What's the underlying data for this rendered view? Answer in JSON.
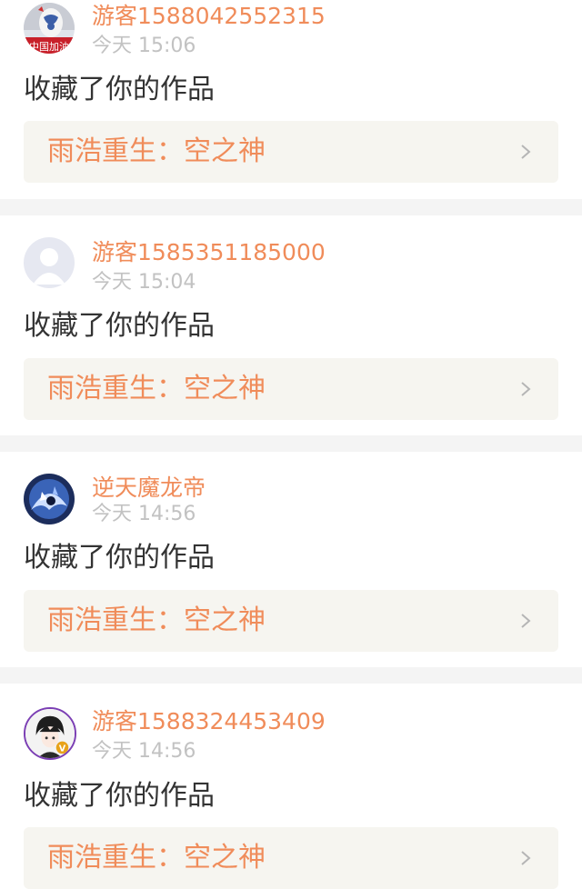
{
  "notifications": [
    {
      "user": "游客1588042552315",
      "time": "今天 15:06",
      "action": "收藏了你的作品",
      "work": "雨浩重生：空之神",
      "avatar": "porcelain-avatar",
      "avatar_text": "中国加油"
    },
    {
      "user": "游客1585351185000",
      "time": "今天 15:04",
      "action": "收藏了你的作品",
      "work": "雨浩重生：空之神",
      "avatar": "default-user-avatar"
    },
    {
      "user": "逆天魔龙帝",
      "time": "今天 14:56",
      "action": "收藏了你的作品",
      "work": "雨浩重生：空之神",
      "avatar": "dragon-avatar"
    },
    {
      "user": "游客1588324453409",
      "time": "今天 14:56",
      "action": "收藏了你的作品",
      "work": "雨浩重生：空之神",
      "avatar": "anime-boy-avatar",
      "avatar_badge": "V"
    }
  ],
  "colors": {
    "accent": "#f08c5a",
    "text": "#333333",
    "muted": "#c2c2c2",
    "work_bg": "#f6f5f0",
    "separator": "#f4f4f4"
  }
}
